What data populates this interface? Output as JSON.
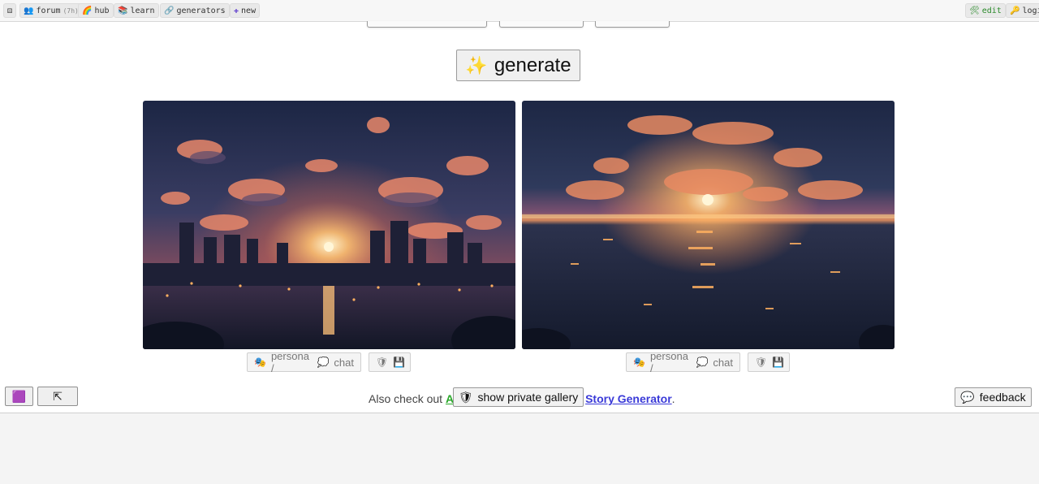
{
  "topbar": {
    "items": [
      {
        "icon": "dice-icon",
        "glyph": "⚄",
        "label": ""
      },
      {
        "icon": "people-icon",
        "glyph": "👥",
        "label": "forum",
        "sub": "(7h)"
      },
      {
        "icon": "rainbow-icon",
        "glyph": "🌈",
        "label": "hub"
      },
      {
        "icon": "books-icon",
        "glyph": "📚",
        "label": "learn"
      },
      {
        "icon": "chain-icon",
        "glyph": "🔗",
        "label": "generators"
      },
      {
        "icon": "plus-icon",
        "glyph": "✚",
        "label": "new"
      }
    ],
    "right": [
      {
        "icon": "wrench-icon",
        "glyph": "🛠",
        "label": "edit"
      },
      {
        "icon": "key-icon",
        "glyph": "🔑",
        "label": "logi"
      }
    ]
  },
  "generate": {
    "icon": "sparkles-icon",
    "glyph": "✨",
    "label": "generate"
  },
  "image_actions": {
    "persona_label": "persona /",
    "chat_label": "chat",
    "persona_glyph": "🎭",
    "chat_glyph": "💭",
    "shield_glyph": "🛡",
    "save_glyph": "💾"
  },
  "footer": {
    "also_text": "Also check out ",
    "link1": "A",
    "link2": "Story Generator",
    "period": ".",
    "private_gallery": {
      "glyph": "🛡",
      "label": "show private gallery"
    },
    "feedback": {
      "glyph": "💬",
      "label": "feedback"
    },
    "left_btn_glyph": "🟪",
    "up_btn_glyph": "⇱"
  },
  "colors": {
    "green_link": "#2aa82a",
    "blue_link": "#3a3ad8",
    "sky_dark": "#1c2440",
    "sun": "#ffcf7a"
  }
}
